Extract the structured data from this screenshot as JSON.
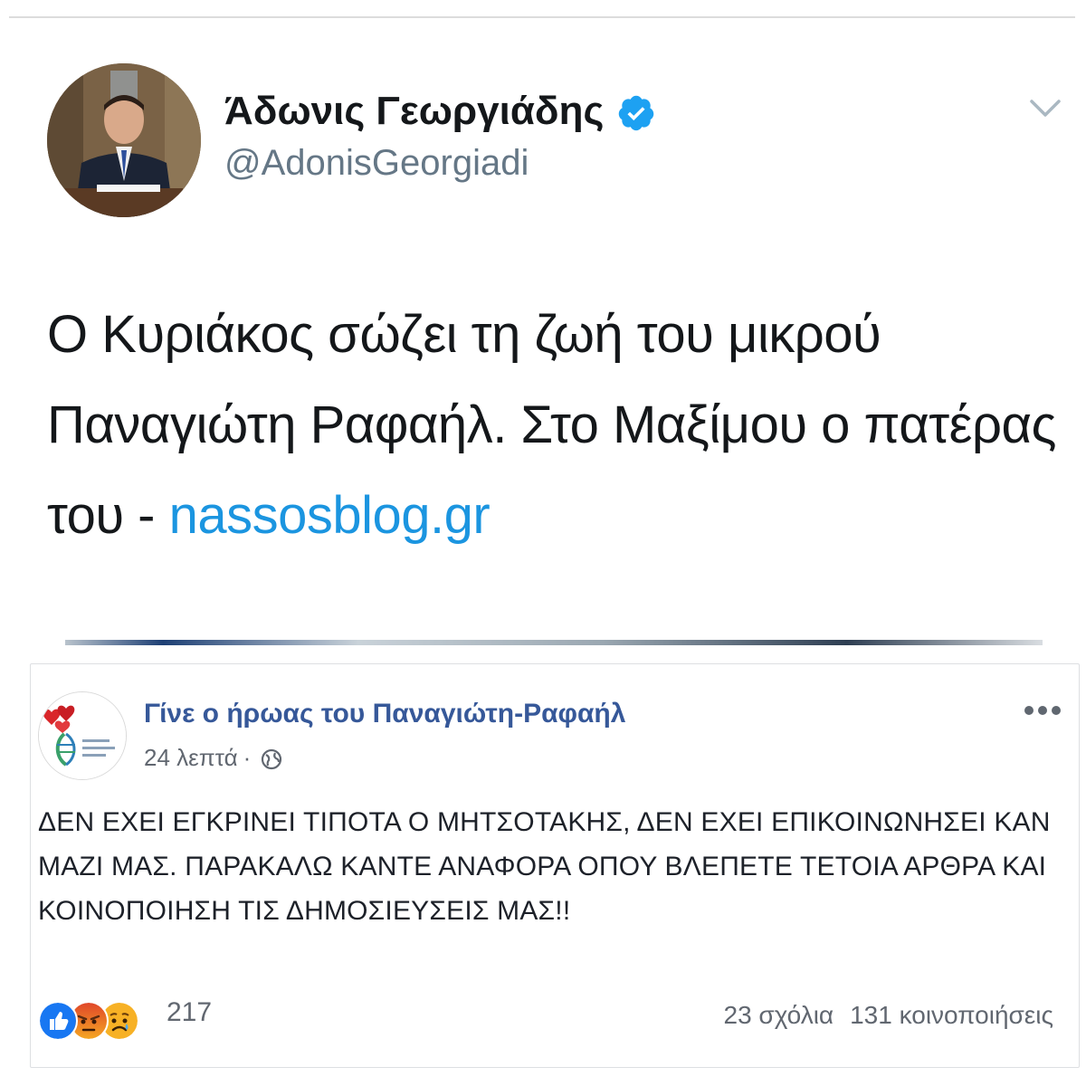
{
  "tweet": {
    "display_name": "Άδωνις Γεωργιάδης",
    "handle": "@AdonisGeorgiadi",
    "text": "Ο Κυριάκος σώζει τη ζωή του μικρού Παναγιώτη Ραφαήλ. Στο Μαξίμου ο πατέρας του - ",
    "link": "nassosblog.gr",
    "verified_icon": "verified-badge-icon",
    "menu_icon": "chevron-down-icon",
    "colors": {
      "link": "#1b95e0",
      "verified": "#1da1f2"
    }
  },
  "facebook_post": {
    "page_name": "Γίνε ο ήρωας του Παναγιώτη-Ραφαήλ",
    "time": "24 λεπτά",
    "separator": "·",
    "privacy_icon": "globe-icon",
    "more_icon": "more-dots-icon",
    "text": "ΔΕΝ ΕΧΕΙ ΕΓΚΡΙΝΕΙ ΤΙΠΟΤΑ Ο ΜΗΤΣΟΤΑΚΗΣ, ΔΕΝ ΕΧΕΙ ΕΠΙΚΟΙΝΩΝΗΣΕΙ ΚΑΝ ΜΑΖΙ ΜΑΣ. ΠΑΡΑΚΑΛΩ ΚΑΝΤΕ ΑΝΑΦΟΡΑ ΟΠΟΥ ΒΛΕΠΕΤΕ ΤΕΤΟΙΑ ΑΡΘΡΑ ΚΑΙ ΚΟΙΝΟΠΟΙΗΣΗ ΤΙΣ ΔΗΜΟΣΙΕΥΣΕΙΣ ΜΑΣ!!",
    "reactions": [
      "like-reaction-icon",
      "angry-reaction-icon",
      "sad-reaction-icon"
    ],
    "reaction_count": "217",
    "comments": "23 σχόλια",
    "shares": "131 κοινοποιήσεις",
    "colors": {
      "page_name": "#365899",
      "like": "#1877f2",
      "angry": "#e9710f",
      "sad": "#f7b125"
    }
  }
}
